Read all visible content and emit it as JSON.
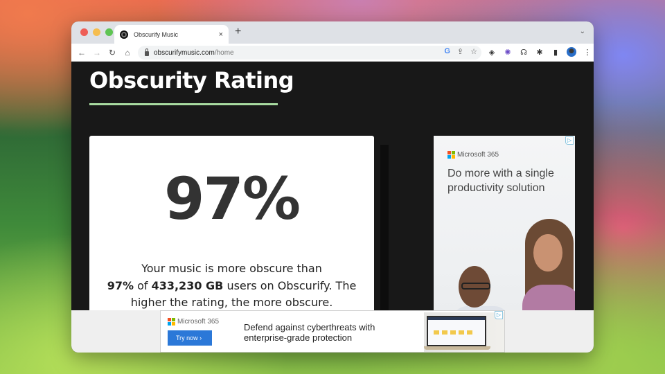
{
  "browser": {
    "tab_title": "Obscurify Music",
    "tab_close": "×",
    "new_tab": "+",
    "tab_menu": "⌄",
    "nav": {
      "back": "←",
      "forward": "→",
      "reload": "↻",
      "home": "⌂"
    },
    "url_host": "obscurifymusic.com",
    "url_path": "/home",
    "omnibox_icons": {
      "google": "G",
      "share": "⇪",
      "bookmark": "☆"
    },
    "extension_icons": {
      "layers": "◈",
      "extension2": "✺",
      "headphones": "☊",
      "puzzle": "✱",
      "sidepanel": "▮",
      "menu": "⋮"
    }
  },
  "page": {
    "title": "Obscurity Rating",
    "rating": {
      "percent_display": "97%",
      "value_percent": 97,
      "desc_line1": "Your music is more obscure than",
      "desc_bold_percent": "97%",
      "desc_of": " of ",
      "desc_bold_users": "433,230 GB",
      "desc_line2_rest": " users on Obscurify. The",
      "desc_line3": "higher the rating, the more obscure."
    },
    "colors": {
      "accent_underline": "#a8dba0",
      "page_bg": "#181818",
      "card_text": "#333333"
    }
  },
  "ads": {
    "side": {
      "brand": "Microsoft 365",
      "headline": "Do more with a single productivity solution",
      "adchoice": "▷"
    },
    "bottom": {
      "brand": "Microsoft 365",
      "button_label": "Try now ›",
      "headline_line1": "Defend against cyberthreats with",
      "headline_line2": "enterprise-grade protection",
      "adchoice": "▷"
    }
  }
}
